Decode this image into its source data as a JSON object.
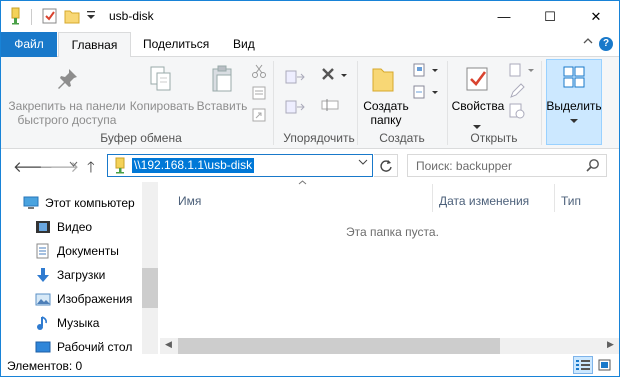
{
  "window": {
    "title": "usb-disk",
    "accent": "#1979ca",
    "minimize": "—",
    "maximize": "☐",
    "close": "✕"
  },
  "ribbon_tabs": {
    "file": "Файл",
    "home": "Главная",
    "share": "Поделиться",
    "view": "Вид",
    "help": "?"
  },
  "ribbon": {
    "pin": "Закрепить на панели быстрого доступа",
    "pin_l1": "Закрепить на панели",
    "pin_l2": "быстрого доступа",
    "copy": "Копировать",
    "paste": "Вставить",
    "clipboard_group": "Буфер обмена",
    "organize_group": "Упорядочить",
    "new_folder_l1": "Создать",
    "new_folder_l2": "папку",
    "create_group": "Создать",
    "properties": "Свойства",
    "open_group": "Открыть",
    "select": "Выделить"
  },
  "address": {
    "path": "\\\\192.168.1.1\\usb-disk",
    "search_placeholder": "Поиск: backupper"
  },
  "nav_pane": {
    "items": [
      {
        "label": "Этот компьютер",
        "icon": "computer-icon"
      },
      {
        "label": "Видео",
        "icon": "video-folder-icon"
      },
      {
        "label": "Документы",
        "icon": "documents-folder-icon"
      },
      {
        "label": "Загрузки",
        "icon": "downloads-folder-icon"
      },
      {
        "label": "Изображения",
        "icon": "pictures-folder-icon"
      },
      {
        "label": "Музыка",
        "icon": "music-folder-icon"
      },
      {
        "label": "Рабочий стол",
        "icon": "desktop-folder-icon"
      }
    ]
  },
  "content": {
    "columns": [
      "Имя",
      "Дата изменения",
      "Тип"
    ],
    "empty_message": "Эта папка пуста."
  },
  "status": {
    "items_count": "Элементов: 0"
  }
}
